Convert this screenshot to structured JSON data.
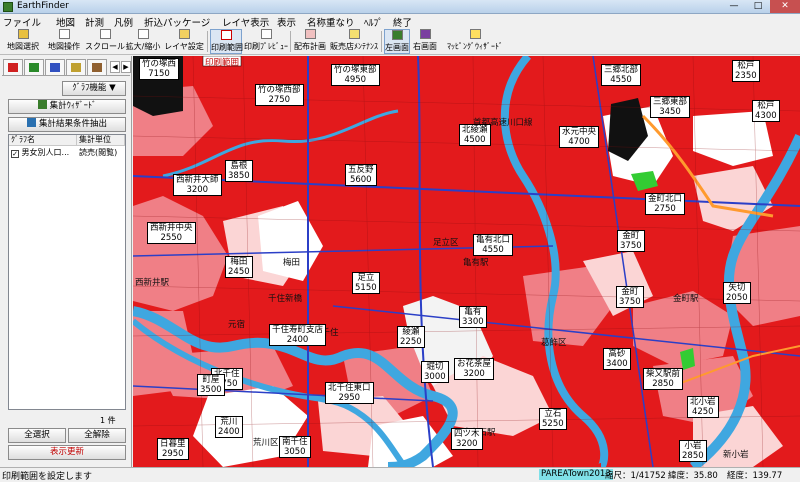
{
  "window": {
    "title": "EarthFinder",
    "min": "—",
    "max": "□",
    "close": "✕"
  },
  "menu": [
    "ファイル",
    "地図",
    "計測",
    "凡例",
    "折込パッケージ",
    "レイヤ表示",
    "表示",
    "名称重なり",
    "ﾍﾙﾌﾟ",
    "終了"
  ],
  "toolbar": {
    "map_select": "地図選択",
    "map_operate": "地図操作",
    "scroll": "スクロール",
    "zoom": "拡大/縮小",
    "layer_settings": "レイヤ設定",
    "print_range": "印刷範囲",
    "print_preview": "印刷ﾌﾟﾚﾋﾞｭｰ",
    "delivery_plan": "配布計画",
    "store_maint": "販売店ﾒﾝﾃﾅﾝｽ",
    "left_screen": "左画面",
    "right_screen": "右画面",
    "mapping_wizard": "ﾏｯﾋﾟﾝｸﾞｳｨｻﾞｰﾄﾞ"
  },
  "left_panel": {
    "graph_function": "ｸﾞﾗﾌ機能 ▼",
    "graph_wizard": "集計ｳｨｻﾞｰﾄﾞ",
    "extract_conditions": "集計結果条件抽出",
    "columns": [
      "ｸﾞﾗﾌ名",
      "集計単位"
    ],
    "rows": [
      {
        "check": "✓",
        "name": "男女別人口...",
        "unit": "読売(閲覧)"
      }
    ],
    "count": "1 件",
    "select_all": "全選択",
    "clear_all": "全解除",
    "refresh": "表示更新"
  },
  "map": {
    "colors": {
      "high": "#e31a1c",
      "mid": "#f07f86",
      "low": "#fbd5d5",
      "river": "#3fa7e0",
      "road": "#2b3fc7"
    },
    "labels": [
      {
        "name": "竹の塚西",
        "value": "7150"
      },
      {
        "name": "竹の塚東部",
        "value": "4950"
      },
      {
        "name": "竹の塚西部",
        "value": "2750"
      },
      {
        "name": "三郷北部",
        "value": "4550"
      },
      {
        "name": "松戸",
        "value": "2350"
      },
      {
        "name": "三郷東部",
        "value": "3450"
      },
      {
        "name": "松戸",
        "value": "4300"
      },
      {
        "name": "北綾瀬",
        "value": "4500"
      },
      {
        "name": "水元中央",
        "value": "4700"
      },
      {
        "name": "島根",
        "value": "3850"
      },
      {
        "name": "五反野",
        "value": "5600"
      },
      {
        "name": "西新井大師",
        "value": "3200"
      },
      {
        "name": "金町北口",
        "value": "2750"
      },
      {
        "name": "亀有北口",
        "value": "4550"
      },
      {
        "name": "金町",
        "value": "3750"
      },
      {
        "name": "西新井中央",
        "value": "2550"
      },
      {
        "name": "梅田",
        "value": "2450"
      },
      {
        "name": "足立",
        "value": "5150"
      },
      {
        "name": "金町",
        "value": "3750"
      },
      {
        "name": "矢切",
        "value": "2050"
      },
      {
        "name": "千住寿町支店",
        "value": "2400"
      },
      {
        "name": "綾瀬",
        "value": "2250"
      },
      {
        "name": "亀有",
        "value": "3300"
      },
      {
        "name": "高砂",
        "value": "3400"
      },
      {
        "name": "北千住",
        "value": "2750"
      },
      {
        "name": "堀切",
        "value": "3000"
      },
      {
        "name": "お花茶屋",
        "value": "3200"
      },
      {
        "name": "町屋",
        "value": "3500"
      },
      {
        "name": "北千住東口",
        "value": "2950"
      },
      {
        "name": "柴又駅前",
        "value": "2850"
      },
      {
        "name": "北小岩",
        "value": "4250"
      },
      {
        "name": "荒川",
        "value": "2400"
      },
      {
        "name": "四ツ木",
        "value": "3200"
      },
      {
        "name": "立石",
        "value": "5250"
      },
      {
        "name": "日暮里",
        "value": "2950"
      },
      {
        "name": "南千住",
        "value": "3050"
      },
      {
        "name": "小岩",
        "value": "2850"
      }
    ],
    "streets": [
      "首都高速川口線",
      "西新井駅",
      "梅田",
      "千住新橋",
      "元宿",
      "北千住",
      "亀有駅",
      "新小岩",
      "金町駅",
      "高砂",
      "京成立石駅",
      "葛飾区",
      "足立区",
      "荒川区"
    ],
    "print_range_tag": "印刷範囲"
  },
  "status": {
    "message": "印刷範囲を設定します",
    "parea": "PAREATown2013",
    "scale": "縮尺：1/41752",
    "lat": "緯度：35.80",
    "lon": "経度：139.77"
  }
}
